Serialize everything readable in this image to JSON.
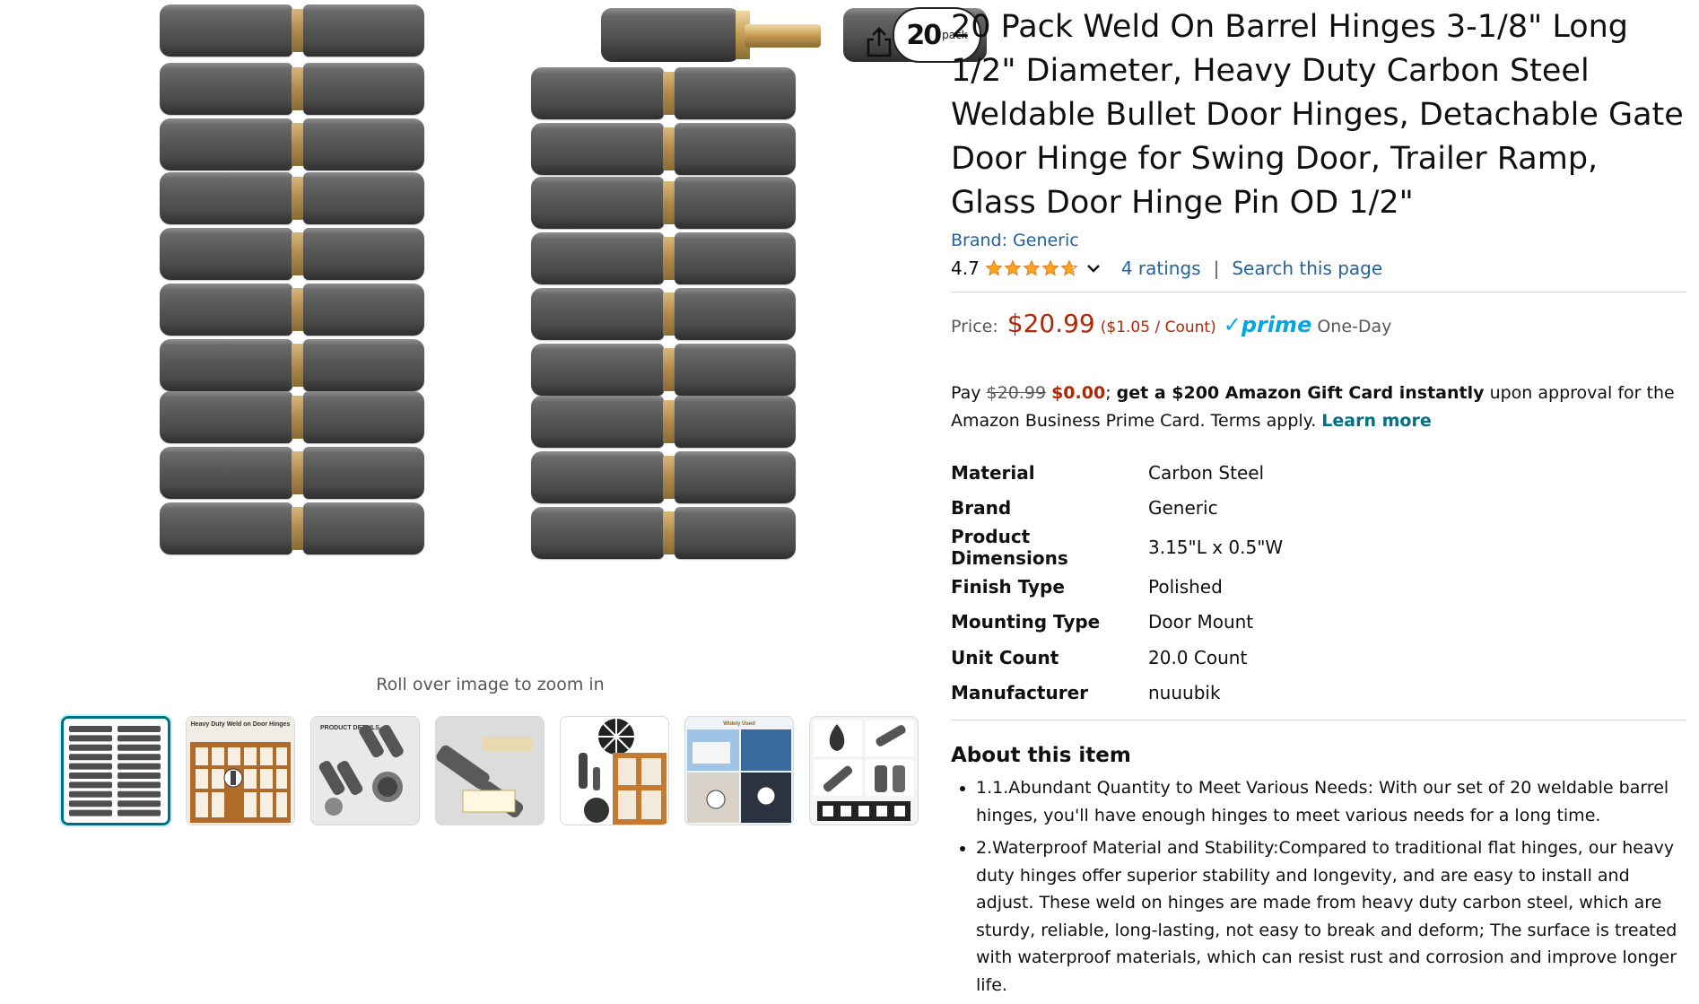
{
  "gallery": {
    "badge_number": "20",
    "badge_word": "pack",
    "zoom_hint": "Roll over image to zoom in",
    "thumbnails": [
      {
        "name": "thumb-hinge-grid",
        "active": true
      },
      {
        "name": "thumb-heavy-duty-weld",
        "text": "Heavy Duty Weld on Door Hinges"
      },
      {
        "name": "thumb-product-details",
        "text": "PRODUCT DETAILS"
      },
      {
        "name": "thumb-single-hinge"
      },
      {
        "name": "thumb-gate-usage"
      },
      {
        "name": "thumb-trailer-usage",
        "text": "Widely Used"
      },
      {
        "name": "thumb-features-grid"
      }
    ]
  },
  "product": {
    "title": "20 Pack Weld On Barrel Hinges 3-1/8\" Long 1/2\" Diameter, Heavy Duty Carbon Steel Weldable Bullet Door Hinges, Detachable Gate Door Hinge for Swing Door, Trailer Ramp, Glass Door Hinge Pin OD 1/2\"",
    "brand_link": "Brand: Generic",
    "rating_value": "4.7",
    "rating_stars": 4.7,
    "ratings_link": "4 ratings",
    "separator": "|",
    "search_link": "Search this page",
    "price_label": "Price:",
    "price": "$20.99",
    "price_per_unit": "($1.05 / Count)",
    "prime_check": "✓",
    "prime_word": "prime",
    "prime_speed": "One-Day"
  },
  "promo": {
    "pay": "Pay",
    "old_price": "$20.99",
    "new_price": "$0.00",
    "semicolon": ";",
    "gift_text": "get a $200 Amazon Gift Card instantly",
    "rest": "upon approval for the Amazon Business Prime Card. Terms apply.",
    "learn_more": "Learn more"
  },
  "specs": [
    {
      "key": "Material",
      "value": "Carbon Steel"
    },
    {
      "key": "Brand",
      "value": "Generic"
    },
    {
      "key": "Product Dimensions",
      "value": "3.15\"L x 0.5\"W"
    },
    {
      "key": "Finish Type",
      "value": "Polished"
    },
    {
      "key": "Mounting Type",
      "value": "Door Mount"
    },
    {
      "key": "Unit Count",
      "value": "20.0 Count"
    },
    {
      "key": "Manufacturer",
      "value": "nuuubik"
    }
  ],
  "about": {
    "title": "About this item",
    "bullets": [
      "1.1.Abundant Quantity to Meet Various Needs: With our set of 20 weldable barrel hinges, you'll have enough hinges to meet various needs for a long time.",
      "2.Waterproof Material and Stability:Compared to traditional flat hinges, our heavy duty hinges offer superior stability and longevity, and are easy to install and adjust. These weld on hinges are made from heavy duty carbon steel, which are sturdy, reliable, long-lasting, not easy to break and deform; The surface is treated with waterproof materials, which can resist rust and corrosion and improve longer life."
    ]
  },
  "colors": {
    "link": "#2162a1",
    "price": "#B12704",
    "star": "#FFA41C",
    "prime": "#00A8E1",
    "teal": "#007185"
  }
}
